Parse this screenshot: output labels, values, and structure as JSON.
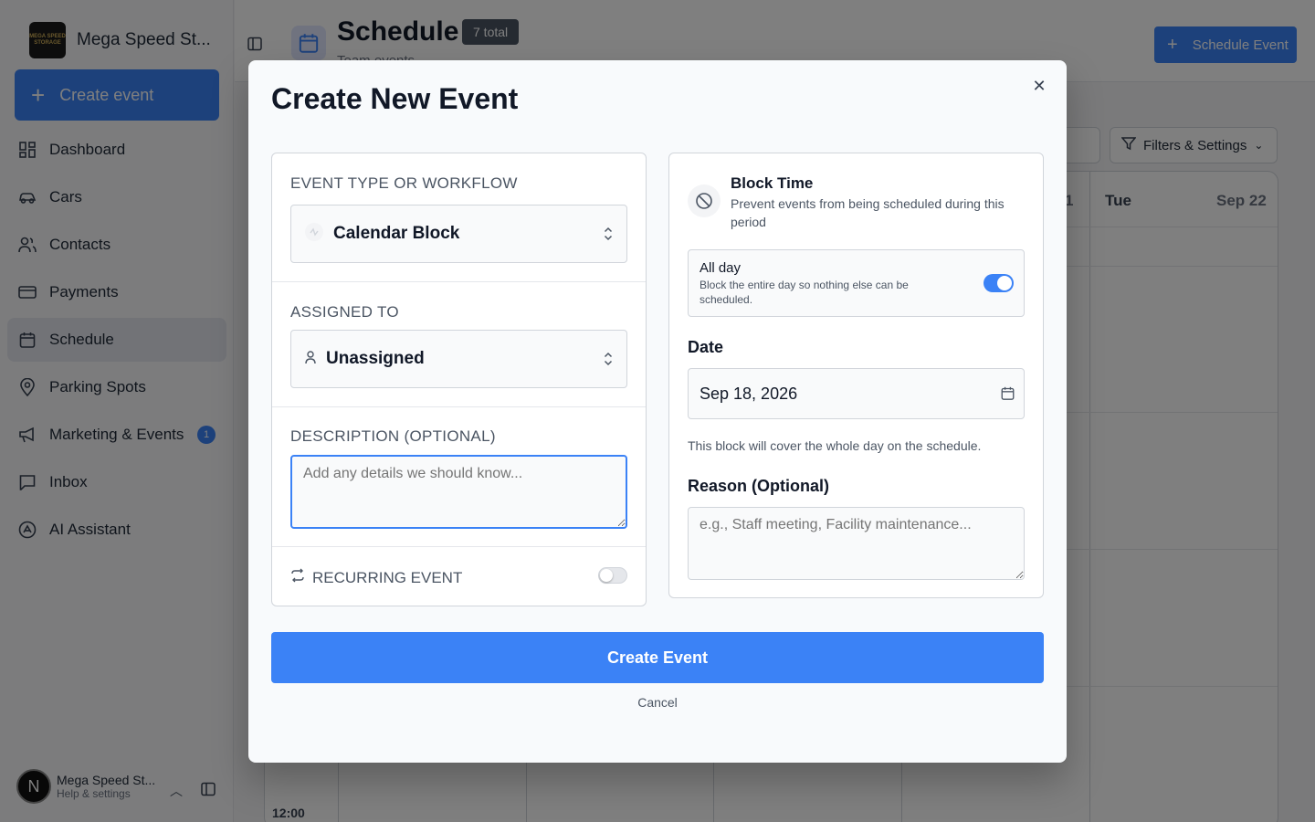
{
  "sidebar": {
    "brand_name": "Mega Speed St...",
    "brand_logo_text": "MEGA SPEED STORAGE",
    "create_label": "Create event",
    "items": [
      {
        "label": "Dashboard",
        "icon": "dashboard-icon"
      },
      {
        "label": "Cars",
        "icon": "car-icon"
      },
      {
        "label": "Contacts",
        "icon": "contacts-icon"
      },
      {
        "label": "Payments",
        "icon": "payments-icon"
      },
      {
        "label": "Schedule",
        "icon": "calendar-icon",
        "active": true
      },
      {
        "label": "Parking Spots",
        "icon": "map-pin-icon"
      },
      {
        "label": "Marketing & Events",
        "icon": "megaphone-icon",
        "badge": "1"
      },
      {
        "label": "Inbox",
        "icon": "inbox-icon"
      },
      {
        "label": "AI Assistant",
        "icon": "ai-icon"
      }
    ],
    "user": {
      "initial": "N",
      "name": "Mega Speed St...",
      "sub": "Help & settings"
    }
  },
  "header": {
    "title": "Schedule",
    "total_badge": "7 total",
    "subtitle": "Team events",
    "schedule_button": "Schedule Event"
  },
  "calendar": {
    "filters_label": "Filters & Settings",
    "visible_days": [
      {
        "day": "Tue",
        "date": "Sep 22"
      }
    ],
    "partial_date": "1",
    "time_label": "12:00"
  },
  "modal": {
    "title": "Create New Event",
    "event_type_label": "EVENT TYPE OR WORKFLOW",
    "event_type_value": "Calendar Block",
    "assigned_label": "ASSIGNED TO",
    "assigned_value": "Unassigned",
    "description_label": "DESCRIPTION (OPTIONAL)",
    "description_placeholder": "Add any details we should know...",
    "recurring_label": "RECURRING EVENT",
    "recurring_on": false,
    "block": {
      "title": "Block Time",
      "description": "Prevent events from being scheduled during this period",
      "allday_title": "All day",
      "allday_desc": "Block the entire day so nothing else can be scheduled.",
      "allday_on": true,
      "date_label": "Date",
      "date_value": "Sep 18, 2026",
      "date_help": "This block will cover the whole day on the schedule.",
      "reason_label": "Reason (Optional)",
      "reason_placeholder": "e.g., Staff meeting, Facility maintenance..."
    },
    "submit_label": "Create Event",
    "cancel_label": "Cancel"
  },
  "colors": {
    "accent": "#3b82f6",
    "overlay": "rgba(0,0,0,0.5)"
  }
}
